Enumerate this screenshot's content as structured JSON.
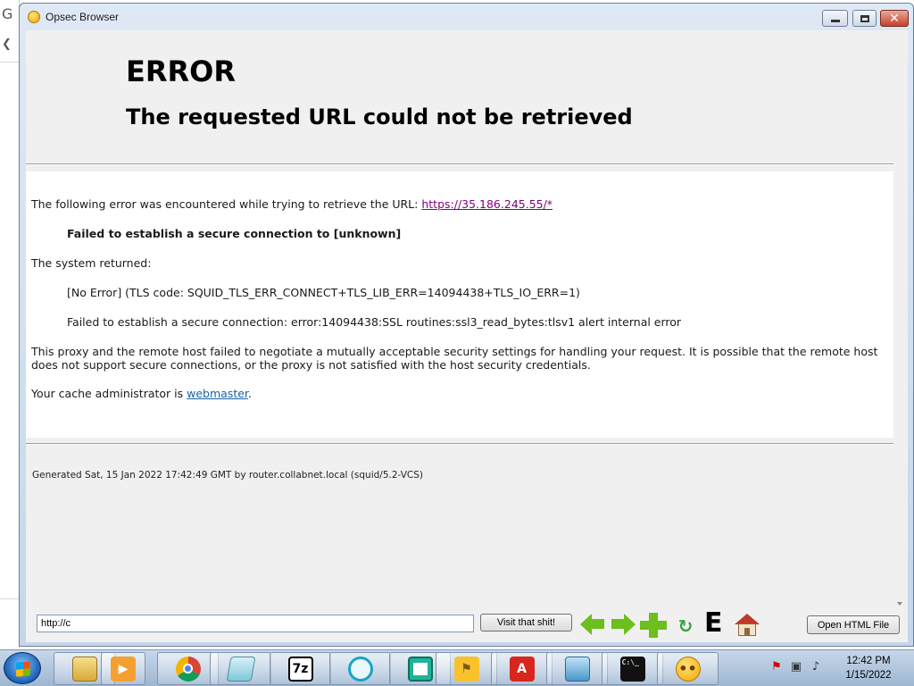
{
  "window": {
    "title": "Opsec Browser"
  },
  "page": {
    "heading": "ERROR",
    "subheading": "The requested URL could not be retrieved",
    "intro_text": "The following error was encountered while trying to retrieve the URL: ",
    "url_link": "https://35.186.245.55/*",
    "failure_message": "Failed to establish a secure connection to [unknown]",
    "system_returned_label": "The system returned:",
    "tls_error": "[No Error] (TLS code: SQUID_TLS_ERR_CONNECT+TLS_LIB_ERR=14094438+TLS_IO_ERR=1)",
    "ssl_error": "Failed to establish a secure connection: error:14094438:SSL routines:ssl3_read_bytes:tlsv1 alert internal error",
    "explanation": "This proxy and the remote host failed to negotiate a mutually acceptable security settings for handling your request. It is possible that the remote host does not support secure connections, or the proxy is not satisfied with the host security credentials.",
    "admin_text": "Your cache administrator is ",
    "admin_link": "webmaster",
    "admin_suffix": ".",
    "footer": "Generated Sat, 15 Jan 2022 17:42:49 GMT by router.collabnet.local (squid/5.2-VCS)"
  },
  "toolbar": {
    "url_value": "http://c",
    "visit_button": "Visit that shit!",
    "open_html_button": "Open HTML File",
    "e_label": "E",
    "icons": [
      "back-arrow-icon",
      "forward-arrow-icon",
      "add-icon",
      "refresh-icon",
      "e-icon",
      "home-icon"
    ],
    "accent_color": "#6cbf1c"
  },
  "taskbar": {
    "apps": [
      {
        "name": "file-explorer-icon",
        "label": ""
      },
      {
        "name": "media-player-icon",
        "label": ""
      },
      {
        "name": "chrome-icon",
        "label": ""
      },
      {
        "name": "notepad-icon",
        "label": ""
      },
      {
        "name": "7zip-icon",
        "label": "7z"
      },
      {
        "name": "app-circle-icon",
        "label": ""
      },
      {
        "name": "app-frame-icon",
        "label": ""
      },
      {
        "name": "app-flag-icon",
        "label": ""
      },
      {
        "name": "acrobat-icon",
        "label": ""
      },
      {
        "name": "control-panel-icon",
        "label": ""
      },
      {
        "name": "command-prompt-icon",
        "label": "C:\\_"
      },
      {
        "name": "opsec-browser-icon",
        "label": ""
      }
    ],
    "clock_time": "12:42 PM",
    "clock_date": "1/15/2022"
  }
}
